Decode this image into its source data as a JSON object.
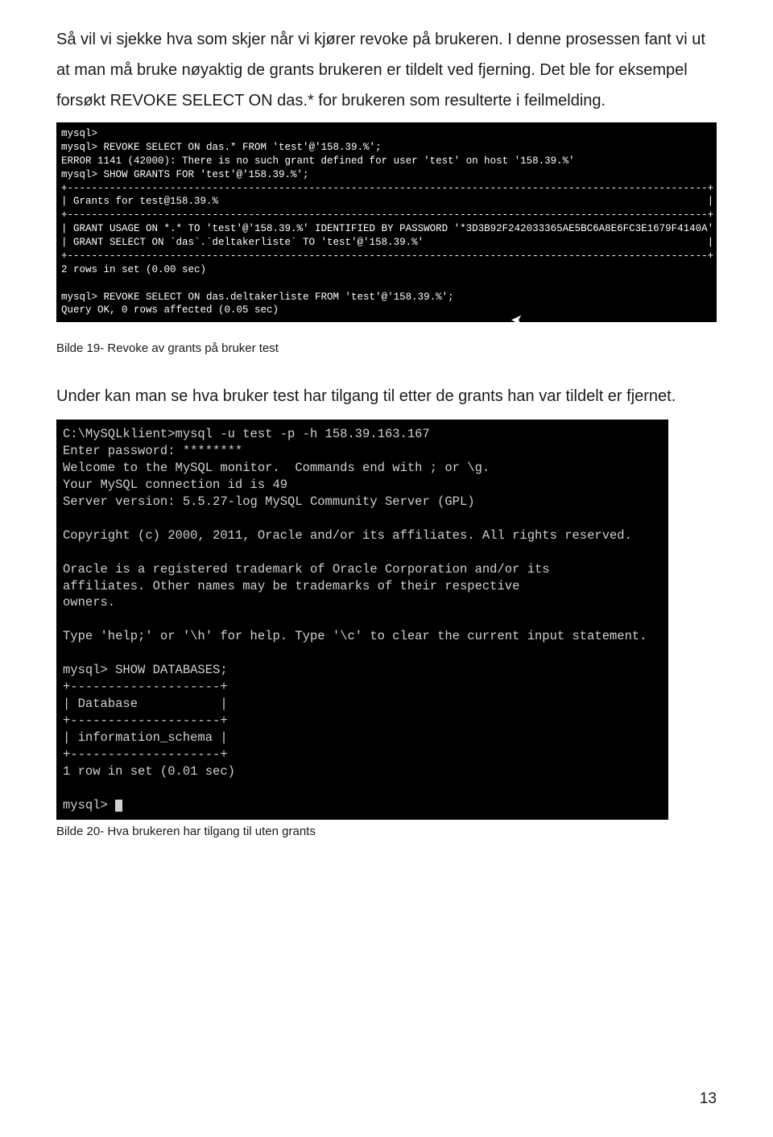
{
  "paragraph1": "Så vil vi sjekke hva som skjer når vi kjører revoke på brukeren. I denne prosessen fant vi ut at man må bruke nøyaktig de grants brukeren er tildelt ved fjerning. Det ble for eksempel forsøkt REVOKE SELECT ON das.* for brukeren som resulterte i feilmelding.",
  "terminal1": "mysql>\nmysql> REVOKE SELECT ON das.* FROM 'test'@'158.39.%';\nERROR 1141 (42000): There is no such grant defined for user 'test' on host '158.39.%'\nmysql> SHOW GRANTS FOR 'test'@'158.39.%';\n+----------------------------------------------------------------------------------------------------------+\n| Grants for test@158.39.%                                                                                 |\n+----------------------------------------------------------------------------------------------------------+\n| GRANT USAGE ON *.* TO 'test'@'158.39.%' IDENTIFIED BY PASSWORD '*3D3B92F242033365AE5BC6A8E6FC3E1679F4140A' |\n| GRANT SELECT ON `das`.`deltakerliste` TO 'test'@'158.39.%'                                               |\n+----------------------------------------------------------------------------------------------------------+\n2 rows in set (0.00 sec)\n\nmysql> REVOKE SELECT ON das.deltakerliste FROM 'test'@'158.39.%';\nQuery OK, 0 rows affected (0.05 sec)",
  "caption1": "Bilde 19- Revoke av grants på bruker test",
  "paragraph2": "Under kan man se hva bruker test har tilgang til etter de grants han var tildelt er fjernet.",
  "terminal2": "C:\\MySQLklient>mysql -u test -p -h 158.39.163.167\nEnter password: ********\nWelcome to the MySQL monitor.  Commands end with ; or \\g.\nYour MySQL connection id is 49\nServer version: 5.5.27-log MySQL Community Server (GPL)\n\nCopyright (c) 2000, 2011, Oracle and/or its affiliates. All rights reserved.\n\nOracle is a registered trademark of Oracle Corporation and/or its\naffiliates. Other names may be trademarks of their respective\nowners.\n\nType 'help;' or '\\h' for help. Type '\\c' to clear the current input statement.\n\nmysql> SHOW DATABASES;\n+--------------------+\n| Database           |\n+--------------------+\n| information_schema |\n+--------------------+\n1 row in set (0.01 sec)\n\nmysql> ",
  "caption2": "Bilde 20- Hva brukeren har tilgang til uten grants",
  "pageNumber": "13"
}
